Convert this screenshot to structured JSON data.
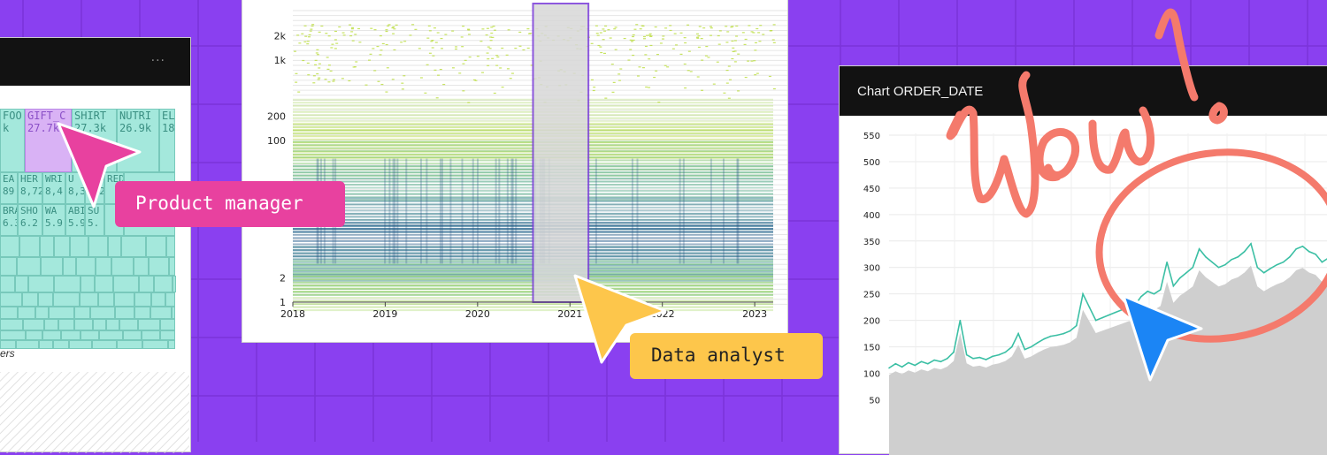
{
  "colors": {
    "background": "#8a40f0",
    "grid_line": "#7b33d8",
    "treemap_fill": "#a4e8dc",
    "treemap_selected": "#d9b2f5",
    "heatmap_high": "#b9dc3a",
    "heatmap_low": "#26568b",
    "selection_outline": "#7a3cd9",
    "line_series": "#3bbfa4",
    "area_fill": "#cfcfcf",
    "annotation": "#f47a6c",
    "pm_cursor": "#e8419f",
    "da_cursor": "#fdc64b",
    "wow_cursor": "#1b85f5"
  },
  "left_panel": {
    "menu_icon": "...",
    "treemap_cells": [
      {
        "label": "FOO",
        "value": "k",
        "selected": false
      },
      {
        "label": "GIFT_C",
        "value": "27.7k",
        "selected": true
      },
      {
        "label": "SHIRT",
        "value": "27.3k",
        "selected": false
      },
      {
        "label": "NUTRI",
        "value": "26.9k",
        "selected": false
      },
      {
        "label": "EL",
        "value": "18",
        "selected": false
      }
    ],
    "small_cells_row1": [
      "EA",
      "HER",
      "WRI",
      "U",
      "CHA",
      "RED"
    ],
    "small_values_row1": [
      "89",
      "8,72",
      "8,4",
      "8,3",
      "8.2",
      ""
    ],
    "small_cells_row2": [
      "BRA",
      "SHO",
      "WA",
      "ABI",
      "SU",
      ""
    ],
    "small_values_row2": [
      "6.3",
      "6.2",
      "5.9",
      "5.9",
      "5.",
      ""
    ],
    "footer_text": "ers"
  },
  "middle_chart": {
    "chart_data": {
      "type": "heatmap",
      "title": "",
      "xlabel": "",
      "ylabel": "",
      "x_ticks": [
        "2018",
        "2019",
        "2020",
        "2021",
        "2022",
        "2023"
      ],
      "y_ticks": [
        "1",
        "2",
        "100",
        "200",
        "1k",
        "2k"
      ],
      "y_scale": "log",
      "x_range": [
        2018,
        2023.2
      ],
      "selection": {
        "x_start": 2020.6,
        "x_end": 2021.2
      },
      "grid": true
    }
  },
  "right_panel": {
    "title": "Chart ORDER_DATE",
    "chart_data": {
      "type": "line",
      "title": "",
      "xlabel": "",
      "ylabel": "",
      "y_ticks": [
        550,
        500,
        450,
        400,
        350,
        300,
        250,
        200,
        150,
        100,
        50
      ],
      "ylim": [
        0,
        570
      ],
      "grid": true,
      "series": [
        {
          "values": [
            110,
            118,
            112,
            120,
            115,
            122,
            118,
            125,
            122,
            128,
            140,
            200,
            135,
            128,
            130,
            126,
            132,
            135,
            140,
            150,
            175,
            145,
            150,
            158,
            165,
            170,
            172,
            175,
            180,
            190,
            250,
            225,
            200,
            205,
            210,
            215,
            220,
            225,
            228,
            245,
            255,
            250,
            258,
            310,
            265,
            280,
            290,
            300,
            335,
            320,
            310,
            300,
            305,
            315,
            320,
            330,
            345,
            300,
            290,
            298,
            305,
            310,
            320,
            335,
            340,
            330,
            325,
            310,
            318,
            320
          ]
        }
      ]
    }
  },
  "annotations": {
    "pm_label": "Product manager",
    "da_label": "Data analyst",
    "wow_text": "Wow!"
  }
}
